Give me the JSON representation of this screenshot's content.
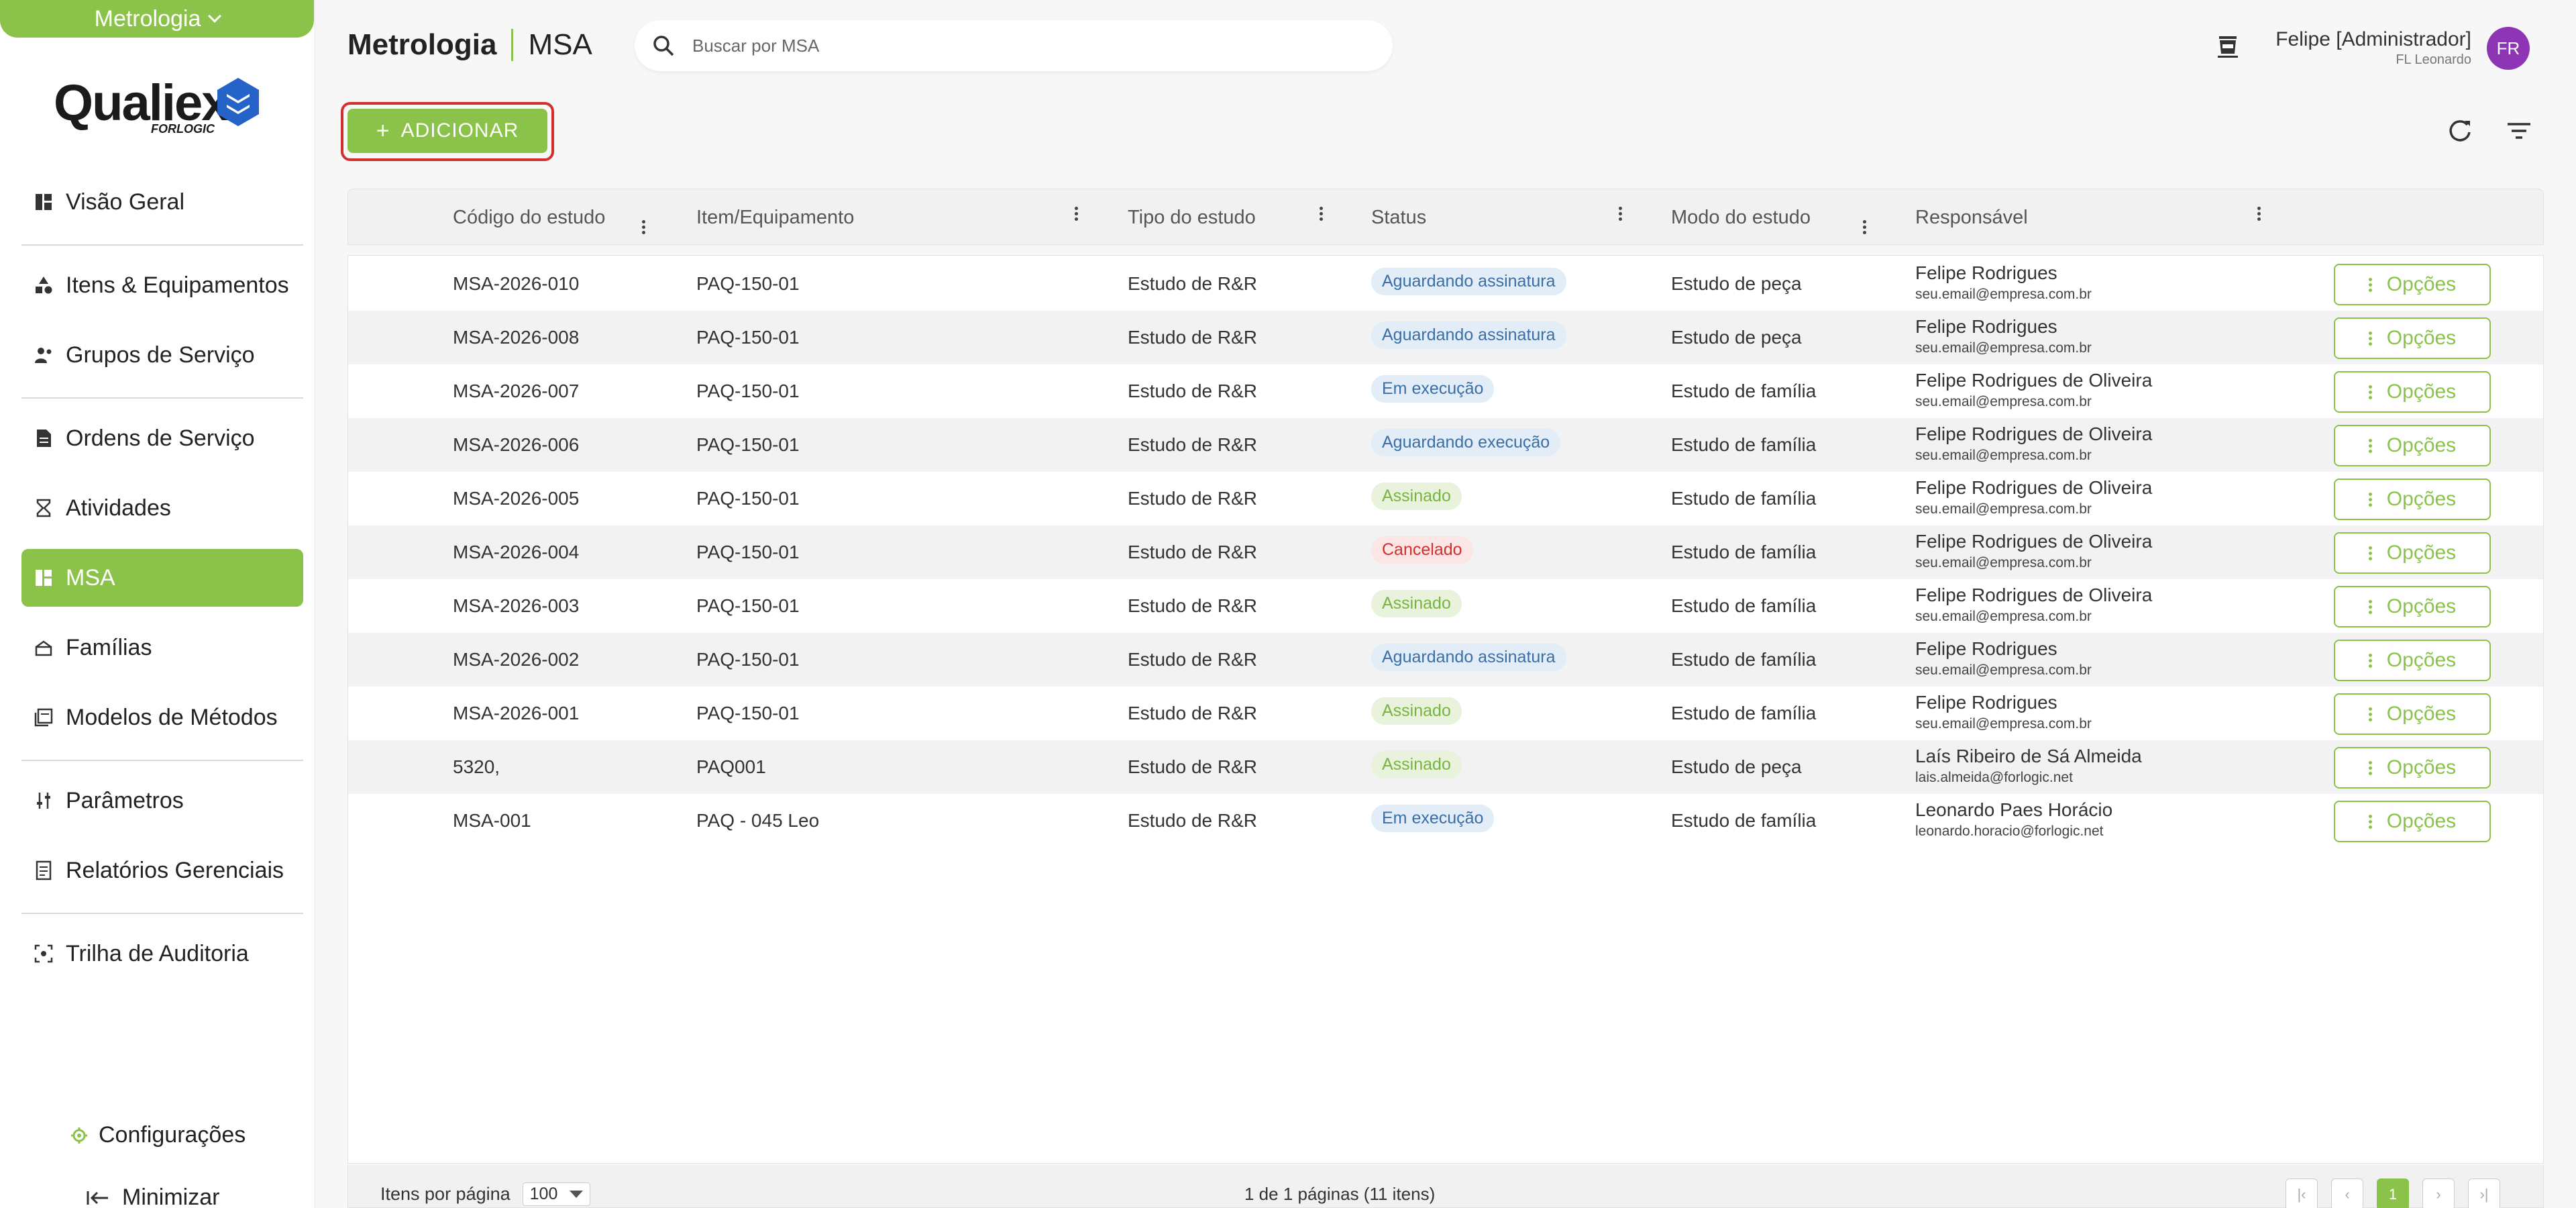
{
  "module_selector": {
    "label": "Metrologia"
  },
  "logo": {
    "brand": "Qualiex",
    "sub": "FORLOGIC"
  },
  "sidebar": {
    "items": [
      {
        "label": "Visão Geral",
        "icon": "dashboard-icon"
      },
      {
        "label": "Itens & Equipamentos",
        "icon": "shapes-icon"
      },
      {
        "label": "Grupos de Serviço",
        "icon": "group-icon"
      },
      {
        "label": "Ordens de Serviço",
        "icon": "document-icon"
      },
      {
        "label": "Atividades",
        "icon": "hourglass-icon"
      },
      {
        "label": "MSA",
        "icon": "grid-icon",
        "active": true
      },
      {
        "label": "Famílias",
        "icon": "stack-icon"
      },
      {
        "label": "Modelos de Métodos",
        "icon": "library-icon"
      },
      {
        "label": "Parâmetros",
        "icon": "sliders-icon"
      },
      {
        "label": "Relatórios Gerenciais",
        "icon": "report-icon"
      },
      {
        "label": "Trilha de Auditoria",
        "icon": "audit-icon"
      }
    ],
    "config_label": "Configurações",
    "minimize_label": "Minimizar"
  },
  "header": {
    "module": "Metrologia",
    "page": "MSA",
    "search_placeholder": "Buscar por MSA",
    "user_name": "Felipe [Administrador]",
    "user_org": "FL Leonardo",
    "avatar_initials": "FR"
  },
  "toolbar": {
    "add_label": "ADICIONAR"
  },
  "table": {
    "columns": [
      "Código do estudo",
      "Item/Equipamento",
      "Tipo do estudo",
      "Status",
      "Modo do estudo",
      "Responsável"
    ],
    "options_label": "Opções",
    "rows": [
      {
        "code": "MSA-2026-010",
        "item": "PAQ-150-01",
        "type": "Estudo de R&R",
        "status": "Aguardando assinatura",
        "status_kind": "blue",
        "mode": "Estudo de peça",
        "resp_name": "Felipe Rodrigues",
        "resp_email": "seu.email@empresa.com.br"
      },
      {
        "code": "MSA-2026-008",
        "item": "PAQ-150-01",
        "type": "Estudo de R&R",
        "status": "Aguardando assinatura",
        "status_kind": "blue",
        "mode": "Estudo de peça",
        "resp_name": "Felipe Rodrigues",
        "resp_email": "seu.email@empresa.com.br"
      },
      {
        "code": "MSA-2026-007",
        "item": "PAQ-150-01",
        "type": "Estudo de R&R",
        "status": "Em execução",
        "status_kind": "blue",
        "mode": "Estudo de família",
        "resp_name": "Felipe Rodrigues de Oliveira",
        "resp_email": "seu.email@empresa.com.br"
      },
      {
        "code": "MSA-2026-006",
        "item": "PAQ-150-01",
        "type": "Estudo de R&R",
        "status": "Aguardando execução",
        "status_kind": "blue",
        "mode": "Estudo de família",
        "resp_name": "Felipe Rodrigues de Oliveira",
        "resp_email": "seu.email@empresa.com.br"
      },
      {
        "code": "MSA-2026-005",
        "item": "PAQ-150-01",
        "type": "Estudo de R&R",
        "status": "Assinado",
        "status_kind": "green",
        "mode": "Estudo de família",
        "resp_name": "Felipe Rodrigues de Oliveira",
        "resp_email": "seu.email@empresa.com.br"
      },
      {
        "code": "MSA-2026-004",
        "item": "PAQ-150-01",
        "type": "Estudo de R&R",
        "status": "Cancelado",
        "status_kind": "red",
        "mode": "Estudo de família",
        "resp_name": "Felipe Rodrigues de Oliveira",
        "resp_email": "seu.email@empresa.com.br"
      },
      {
        "code": "MSA-2026-003",
        "item": "PAQ-150-01",
        "type": "Estudo de R&R",
        "status": "Assinado",
        "status_kind": "green",
        "mode": "Estudo de família",
        "resp_name": "Felipe Rodrigues de Oliveira",
        "resp_email": "seu.email@empresa.com.br"
      },
      {
        "code": "MSA-2026-002",
        "item": "PAQ-150-01",
        "type": "Estudo de R&R",
        "status": "Aguardando assinatura",
        "status_kind": "blue",
        "mode": "Estudo de família",
        "resp_name": "Felipe Rodrigues",
        "resp_email": "seu.email@empresa.com.br"
      },
      {
        "code": "MSA-2026-001",
        "item": "PAQ-150-01",
        "type": "Estudo de R&R",
        "status": "Assinado",
        "status_kind": "green",
        "mode": "Estudo de família",
        "resp_name": "Felipe Rodrigues",
        "resp_email": "seu.email@empresa.com.br"
      },
      {
        "code": "5320,",
        "item": "PAQ001",
        "type": "Estudo de R&R",
        "status": "Assinado",
        "status_kind": "green",
        "mode": "Estudo de peça",
        "resp_name": "Laís Ribeiro de Sá Almeida",
        "resp_email": "lais.almeida@forlogic.net"
      },
      {
        "code": "MSA-001",
        "item": "PAQ - 045 Leo",
        "type": "Estudo de R&R",
        "status": "Em execução",
        "status_kind": "blue",
        "mode": "Estudo de família",
        "resp_name": "Leonardo Paes Horácio",
        "resp_email": "leonardo.horacio@forlogic.net"
      }
    ]
  },
  "footer": {
    "per_page_label": "Itens por página",
    "per_page_value": "100",
    "page_info": "1 de 1 páginas (11 itens)",
    "current_page": "1"
  },
  "colors": {
    "accent": "#8bc34a",
    "highlight": "#d32f2f",
    "avatar": "#8e35b5"
  }
}
